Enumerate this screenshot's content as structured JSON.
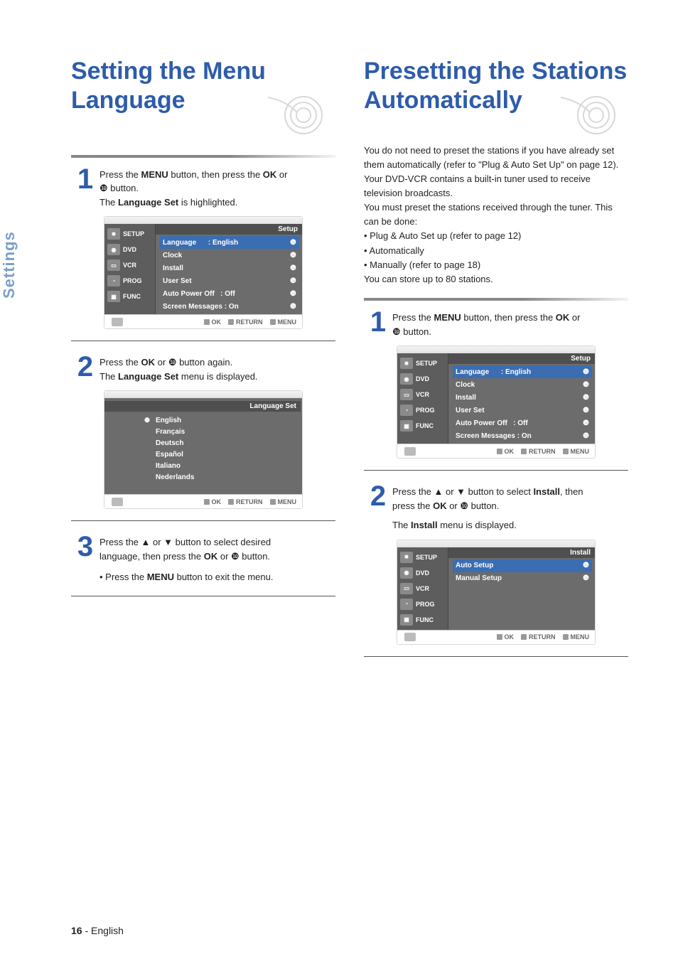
{
  "sideTab": "Settings",
  "pageFooter": {
    "num": "16",
    "dash": " - ",
    "lang": "English"
  },
  "left": {
    "title_l1": "Setting the Menu",
    "title_l2": "Language",
    "step1": {
      "num": "1",
      "line1a": "Press the ",
      "menu": "MENU",
      "line1b": " button, then press the ",
      "ok": "OK",
      "line1c": " or",
      "line2a": "❿ button.",
      "line3a": "The ",
      "ls": "Language Set",
      "line3b": " is highlighted."
    },
    "osd1": {
      "title": "Setup",
      "side": [
        "SETUP",
        "DVD",
        "VCR",
        "PROG",
        "FUNC"
      ],
      "rows": [
        {
          "l": "Language",
          "r": ": English",
          "sel": true
        },
        {
          "l": "Clock",
          "r": ""
        },
        {
          "l": "Install",
          "r": ""
        },
        {
          "l": "User Set",
          "r": ""
        },
        {
          "l": "Auto Power Off",
          "r": ": Off"
        },
        {
          "l": "Screen Messages",
          "r": ": On"
        }
      ],
      "footer": [
        "OK",
        "RETURN",
        "MENU"
      ]
    },
    "step2": {
      "num": "2",
      "line1a": "Press the ",
      "ok": "OK",
      "line1b": " or ❿ button again.",
      "line2a": "The ",
      "ls": "Language Set",
      "line2b": " menu is displayed."
    },
    "osd2": {
      "title": "Language Set",
      "items": [
        "English",
        "Français",
        "Deutsch",
        "Español",
        "Italiano",
        "Nederlands"
      ],
      "footer": [
        "OK",
        "RETURN",
        "MENU"
      ]
    },
    "step3": {
      "num": "3",
      "line1": "Press the ▲ or ▼ button to select desired",
      "line2a": "language, then press the ",
      "ok": "OK",
      "line2b": " or ❿ button.",
      "bullet_a": "• Press the ",
      "menu": "MENU",
      "bullet_b": " button to exit the menu."
    }
  },
  "right": {
    "title_l1": "Presetting the Stations",
    "title_l2": "Automatically",
    "intro": {
      "p1": "You do not need to preset the stations if you have already set them automatically (refer to \"Plug & Auto Set Up\" on page 12).",
      "p2": "Your DVD-VCR contains a built-in tuner used to receive television broadcasts.",
      "p3": "You must preset the stations received through the tuner. This can be done:",
      "b1": "• Plug & Auto Set up (refer to page 12)",
      "b2": "• Automatically",
      "b3": "• Manually (refer to page 18)",
      "p4": "You can store up to 80 stations."
    },
    "step1": {
      "num": "1",
      "line1a": "Press the ",
      "menu": "MENU",
      "line1b": " button, then press the ",
      "ok": "OK",
      "line1c": " or",
      "line2": "❿ button."
    },
    "osd1": {
      "title": "Setup",
      "side": [
        "SETUP",
        "DVD",
        "VCR",
        "PROG",
        "FUNC"
      ],
      "rows": [
        {
          "l": "Language",
          "r": ": English",
          "sel": true
        },
        {
          "l": "Clock",
          "r": ""
        },
        {
          "l": "Install",
          "r": ""
        },
        {
          "l": "User Set",
          "r": ""
        },
        {
          "l": "Auto Power Off",
          "r": ": Off"
        },
        {
          "l": "Screen Messages",
          "r": ": On"
        }
      ],
      "footer": [
        "OK",
        "RETURN",
        "MENU"
      ]
    },
    "step2": {
      "num": "2",
      "line1a": "Press the ▲ or ▼ button to select ",
      "install": "Install",
      "line1b": ", then",
      "line2a": "press the ",
      "ok": "OK",
      "line2b": " or ❿ button.",
      "line3a": "The ",
      "installm": "Install",
      "line3b": " menu is displayed."
    },
    "osd2": {
      "title": "Install",
      "side": [
        "SETUP",
        "DVD",
        "VCR",
        "PROG",
        "FUNC"
      ],
      "rows": [
        {
          "l": "Auto Setup",
          "r": "",
          "sel": true
        },
        {
          "l": "Manual Setup",
          "r": ""
        }
      ],
      "footer": [
        "OK",
        "RETURN",
        "MENU"
      ]
    }
  }
}
